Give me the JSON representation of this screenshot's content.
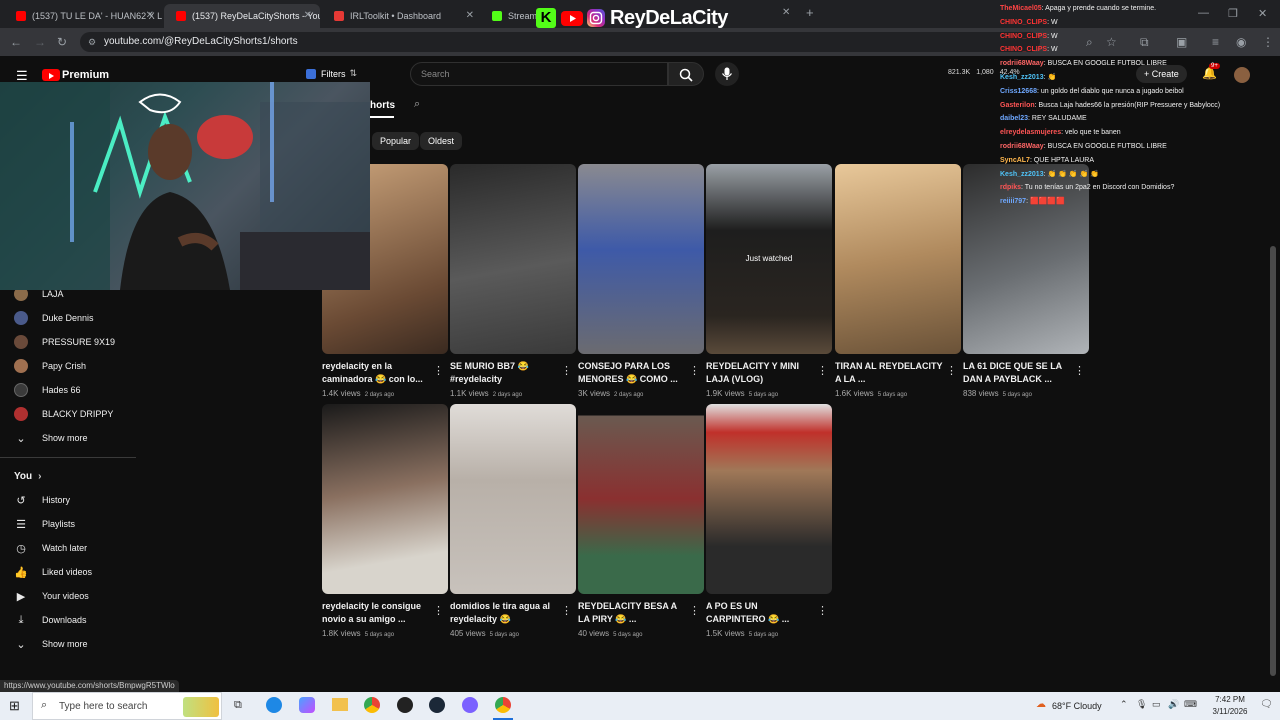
{
  "browser": {
    "tabs": [
      {
        "label": "(1537) TU LE DA' - HUAN62 X L",
        "color": "#ff0000",
        "active": false
      },
      {
        "label": "(1537) ReyDeLaCityShorts - You",
        "color": "#ff0000",
        "active": true
      },
      {
        "label": "IRLToolkit • Dashboard",
        "color": "#e53935",
        "active": false
      },
      {
        "label": "Stream",
        "color": "#53fc18",
        "active": false
      }
    ],
    "url": "youtube.com/@ReyDeLaCityShorts1/shorts"
  },
  "overlay": {
    "brand": "ReyDeLaCity",
    "k_logo": "K"
  },
  "youtube": {
    "logo": "Premium",
    "filters_label": "Filters",
    "search_placeholder": "Search",
    "create_label": "Create",
    "notif_badge": "9+",
    "stats": [
      "821.3K",
      "1,080",
      "42.4%"
    ],
    "tab_shorts": "horts",
    "chips": [
      "Popular",
      "Oldest"
    ],
    "sidebar_subs": [
      {
        "label": "LAJA",
        "color": "#8a6b4a"
      },
      {
        "label": "Duke Dennis",
        "color": "#4a5a8a"
      },
      {
        "label": "PRESSURE 9X19",
        "color": "#6a4a3a"
      },
      {
        "label": "Papy Crish",
        "color": "#a07050"
      },
      {
        "label": "Hades 66",
        "color": "#3a3a3a"
      },
      {
        "label": "BLACKY DRIPPY",
        "color": "#b03030"
      }
    ],
    "sidebar_show_more_1": "Show more",
    "you_header": "You",
    "you_items": [
      {
        "label": "History",
        "icon": "history-icon"
      },
      {
        "label": "Playlists",
        "icon": "playlists-icon"
      },
      {
        "label": "Watch later",
        "icon": "watch-later-icon"
      },
      {
        "label": "Liked videos",
        "icon": "liked-videos-icon"
      },
      {
        "label": "Your videos",
        "icon": "your-videos-icon"
      },
      {
        "label": "Downloads",
        "icon": "downloads-icon"
      }
    ],
    "sidebar_show_more_2": "Show more",
    "watched_label": "Just watched",
    "shorts": [
      {
        "title": "reydelacity en la caminadora 😂 con lo...",
        "views": "1.4K views",
        "ago": "2 days ago",
        "bg": "#7a5a44"
      },
      {
        "title": "SE MURIO BB7 😂 #reydelacity",
        "views": "1.1K views",
        "ago": "2 days ago",
        "bg": "#3d3d3d"
      },
      {
        "title": "CONSEJO PARA LOS MENORES 😂 COMO ...",
        "views": "3K views",
        "ago": "2 days ago",
        "bg": "#5a6070"
      },
      {
        "title": "REYDELACITY Y MINI LAJA (VLOG)",
        "views": "1.9K views",
        "ago": "5 days ago",
        "bg": "#2a2828"
      },
      {
        "title": "TIRAN AL REYDELACITY A LA ...",
        "views": "1.6K views",
        "ago": "5 days ago",
        "bg": "#8a7356"
      },
      {
        "title": "LA 61 DICE QUE SE LA DAN A PAYBLACK ...",
        "views": "838 views",
        "ago": "5 days ago",
        "bg": "#4a4e50"
      },
      {
        "title": "reydelacity le consigue novio a su amigo ...",
        "views": "1.8K views",
        "ago": "5 days ago",
        "bg": "#3a3a3a"
      },
      {
        "title": "domidios le tira agua al reydelacity 😂",
        "views": "405 views",
        "ago": "5 days ago",
        "bg": "#c8c2bc"
      },
      {
        "title": "REYDELACITY BESA A LA PIRY 😂 ...",
        "views": "40 views",
        "ago": "5 days ago",
        "bg": "#5a5050"
      },
      {
        "title": "A PO ES UN CARPINTERO 😂 ...",
        "views": "1.5K views",
        "ago": "5 days ago",
        "bg": "#a07858"
      }
    ]
  },
  "chat": [
    {
      "user": "TheMicael05",
      "msg": "Apaga y prende cuando se termine.",
      "color": "#ff4444"
    },
    {
      "user": "CHINO_CLIPS",
      "msg": "W",
      "color": "#ff3333"
    },
    {
      "user": "CHINO_CLIPS",
      "msg": "W",
      "color": "#ff3333"
    },
    {
      "user": "CHINO_CLIPS",
      "msg": "W",
      "color": "#ff3333"
    },
    {
      "user": "rodrii68Waay",
      "msg": "BUSCA EN GOOGLE FUTBOL LIBRE",
      "color": "#ff6666"
    },
    {
      "user": "Kesh_zz2013",
      "msg": "👏",
      "color": "#4fc3f7"
    },
    {
      "user": "Criss12668",
      "msg": "un goldo del diablo que nunca a jugado beibol",
      "color": "#6fa8ff"
    },
    {
      "user": "Gasterilon",
      "msg": "Busca Laja hades66 la presión(RIP Pressuere y Babylocc)",
      "color": "#ff5555"
    },
    {
      "user": "daibel23",
      "msg": "REY SALUDAME",
      "color": "#6fa8ff"
    },
    {
      "user": "elreydelasmujeres",
      "msg": "velo que te banen",
      "color": "#ff5555"
    },
    {
      "user": "rodrii68Waay",
      "msg": "BUSCA EN GOOGLE FUTBOL LIBRE",
      "color": "#ff6666"
    },
    {
      "user": "SyncAL7",
      "msg": "QUE HPTA LAURA",
      "color": "#ffb74d"
    },
    {
      "user": "Kesh_zz2013",
      "msg": "👏 👏 👏 👏 👏",
      "color": "#4fc3f7"
    },
    {
      "user": "rdpiks",
      "msg": "Tu no tenías un 2pa2 en Discord con Domidios?",
      "color": "#ff5555"
    },
    {
      "user": "reiiii797",
      "msg": "🟥🟥🟥🟥",
      "color": "#6fa8ff"
    }
  ],
  "status_url": "https://www.youtube.com/shorts/BmpwgR5TWlo",
  "taskbar": {
    "search_placeholder": "Type here to search",
    "weather": "68°F  Cloudy",
    "time": "7:42 PM",
    "date": "3/11/2026"
  },
  "colors": {
    "yt_red": "#ff0000",
    "kick_green": "#53fc18",
    "ig": "#e1306c"
  }
}
